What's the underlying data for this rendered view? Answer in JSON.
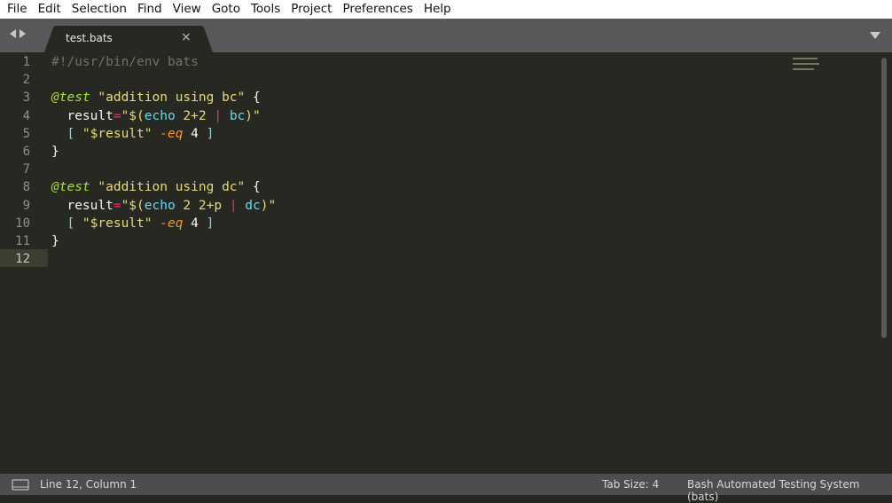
{
  "menu": [
    "File",
    "Edit",
    "Selection",
    "Find",
    "View",
    "Goto",
    "Tools",
    "Project",
    "Preferences",
    "Help"
  ],
  "tab": {
    "title": "test.bats",
    "close": "×"
  },
  "editor": {
    "current_line": 12,
    "line_numbers": [
      "1",
      "2",
      "3",
      "4",
      "5",
      "6",
      "7",
      "8",
      "9",
      "10",
      "11",
      "12"
    ],
    "lines": [
      [
        {
          "t": "#!/usr/bin/env bats",
          "c": "comment"
        }
      ],
      [],
      [
        {
          "t": "@test",
          "c": "keyword"
        },
        {
          "t": " ",
          "c": "plain"
        },
        {
          "t": "\"addition using bc\"",
          "c": "string"
        },
        {
          "t": " {",
          "c": "plain"
        }
      ],
      [
        {
          "t": "  result",
          "c": "plain"
        },
        {
          "t": "=",
          "c": "operator"
        },
        {
          "t": "\"$(",
          "c": "string"
        },
        {
          "t": "echo",
          "c": "builtin"
        },
        {
          "t": " 2+2 ",
          "c": "string"
        },
        {
          "t": "|",
          "c": "operator"
        },
        {
          "t": " ",
          "c": "string"
        },
        {
          "t": "bc",
          "c": "builtin"
        },
        {
          "t": ")\"",
          "c": "string"
        }
      ],
      [
        {
          "t": "  [ ",
          "c": "builtin"
        },
        {
          "t": "\"$result\"",
          "c": "string"
        },
        {
          "t": " ",
          "c": "plain"
        },
        {
          "t": "-eq",
          "c": "flag"
        },
        {
          "t": " 4 ",
          "c": "plain"
        },
        {
          "t": "]",
          "c": "builtin"
        }
      ],
      [
        {
          "t": "}",
          "c": "plain"
        }
      ],
      [],
      [
        {
          "t": "@test",
          "c": "keyword"
        },
        {
          "t": " ",
          "c": "plain"
        },
        {
          "t": "\"addition using dc\"",
          "c": "string"
        },
        {
          "t": " {",
          "c": "plain"
        }
      ],
      [
        {
          "t": "  result",
          "c": "plain"
        },
        {
          "t": "=",
          "c": "operator"
        },
        {
          "t": "\"$(",
          "c": "string"
        },
        {
          "t": "echo",
          "c": "builtin"
        },
        {
          "t": " 2 2+p ",
          "c": "string"
        },
        {
          "t": "|",
          "c": "operator"
        },
        {
          "t": " ",
          "c": "string"
        },
        {
          "t": "dc",
          "c": "builtin"
        },
        {
          "t": ")\"",
          "c": "string"
        }
      ],
      [
        {
          "t": "  [ ",
          "c": "builtin"
        },
        {
          "t": "\"$result\"",
          "c": "string"
        },
        {
          "t": " ",
          "c": "plain"
        },
        {
          "t": "-eq",
          "c": "flag"
        },
        {
          "t": " 4 ",
          "c": "plain"
        },
        {
          "t": "]",
          "c": "builtin"
        }
      ],
      [
        {
          "t": "}",
          "c": "plain"
        }
      ],
      []
    ]
  },
  "status": {
    "position": "Line 12, Column 1",
    "tab_size": "Tab Size: 4",
    "syntax": "Bash Automated Testing System (bats)"
  },
  "colors": {
    "background": "#272822",
    "comment": "#75715e",
    "keyword": "#a6e22e",
    "string": "#e6db74",
    "operator": "#f92672",
    "builtin": "#66d9ef",
    "flag": "#fd971f"
  }
}
